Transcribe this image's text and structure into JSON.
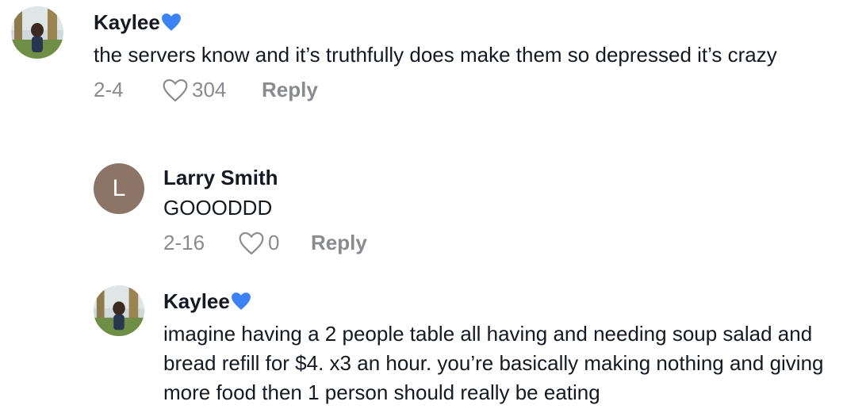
{
  "comments": [
    {
      "username": "Kaylee",
      "badge_icon": "blue-heart-icon",
      "text": "the servers know and it’s truthfully does make them so depressed it’s crazy",
      "date": "2-4",
      "likes": "304",
      "reply_label": "Reply",
      "avatar": "profile-photo"
    },
    {
      "username": "Larry Smith",
      "avatar_letter": "L",
      "avatar_color": "#8c7567",
      "text": "GOOODDD",
      "date": "2-16",
      "likes": "0",
      "reply_label": "Reply"
    },
    {
      "username": "Kaylee",
      "badge_icon": "blue-heart-icon",
      "text": "imagine having a 2 people table all having and needing soup salad and bread refill for $4. x3 an hour. you’re basically making nothing and giving more food then 1 person should really be eating",
      "avatar": "profile-photo"
    }
  ],
  "colors": {
    "meta_gray": "#8a8b91",
    "badge_blue": "#3b82f6",
    "text": "#161823"
  }
}
